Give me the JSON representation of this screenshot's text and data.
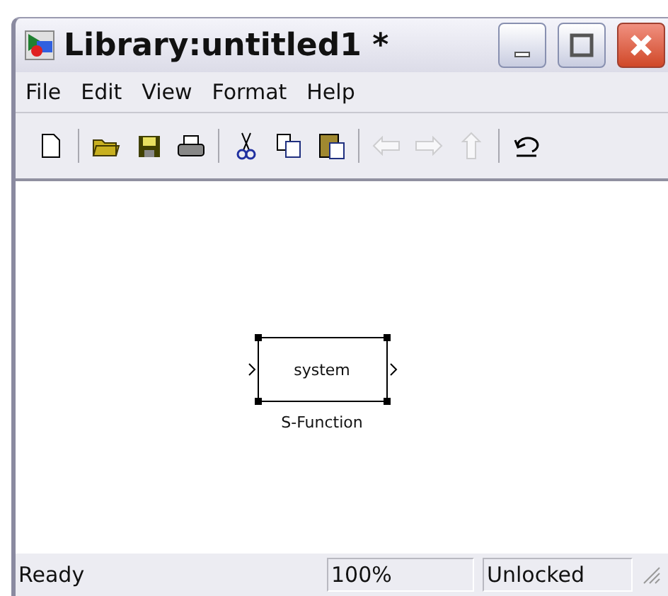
{
  "window": {
    "title": "Library:untitled1 *"
  },
  "menu": [
    {
      "label": "File"
    },
    {
      "label": "Edit"
    },
    {
      "label": "View"
    },
    {
      "label": "Format"
    },
    {
      "label": "Help"
    }
  ],
  "toolbar": {
    "groups": [
      [
        {
          "kind": "new",
          "disabled": false
        }
      ],
      [
        {
          "kind": "open",
          "disabled": false
        },
        {
          "kind": "save",
          "disabled": false
        },
        {
          "kind": "print",
          "disabled": false
        }
      ],
      [
        {
          "kind": "cut",
          "disabled": false
        },
        {
          "kind": "copy",
          "disabled": false
        },
        {
          "kind": "paste",
          "disabled": false
        }
      ],
      [
        {
          "kind": "back",
          "disabled": true
        },
        {
          "kind": "forward",
          "disabled": true
        },
        {
          "kind": "up",
          "disabled": true
        }
      ],
      [
        {
          "kind": "undo",
          "disabled": false
        }
      ]
    ]
  },
  "canvas": {
    "blocks": [
      {
        "text": "system",
        "label": "S-Function",
        "selected": true
      }
    ]
  },
  "status_bar": {
    "message": "Ready",
    "zoom": "100%",
    "lock": "Unlocked"
  }
}
